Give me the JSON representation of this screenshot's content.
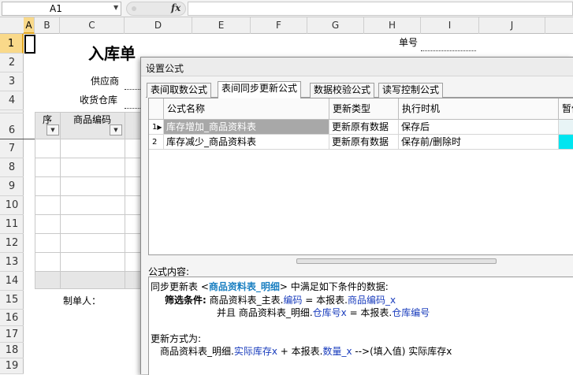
{
  "formula_bar": {
    "cell_ref": "A1",
    "fx_label": "fx"
  },
  "columns": [
    "A",
    "B",
    "C",
    "D",
    "E",
    "F",
    "G",
    "H",
    "I",
    "J"
  ],
  "rows": [
    "1",
    "2",
    "3",
    "4",
    "5",
    "6",
    "7",
    "8",
    "9",
    "10",
    "11",
    "12",
    "13",
    "14",
    "15",
    "16",
    "17",
    "18",
    "19"
  ],
  "sheet": {
    "title": "入库单",
    "doc_no_label": "单号",
    "supplier_label": "供应商",
    "warehouse_label": "收货仓库",
    "table_headers": [
      "序",
      "商品编码"
    ],
    "maker_label": "制单人："
  },
  "dialog": {
    "title": "设置公式",
    "tabs": [
      "表间取数公式",
      "表间同步更新公式",
      "数据校验公式",
      "读写控制公式"
    ],
    "active_tab": 1,
    "grid_headers": [
      "公式名称",
      "更新类型",
      "执行时机",
      "暂停"
    ],
    "grid_rows": [
      {
        "index": "1",
        "name": "库存增加_商品资料表",
        "update_type": "更新原有数据",
        "timing": "保存后"
      },
      {
        "index": "2",
        "name": "库存减少_商品资料表",
        "update_type": "更新原有数据",
        "timing": "保存前/删除时"
      }
    ],
    "formula_label": "公式内容:",
    "formula": {
      "l1_a": "同步更新表 <",
      "l1_b": "商品资料表_明细",
      "l1_c": "> 中满足如下条件的数据:",
      "l2_a": "筛选条件:",
      "l2_b": " 商品资料表_主表.",
      "l2_c": "编码",
      "l2_d": " = 本报表.",
      "l2_e": "商品编码_x",
      "l3_a": "并且 商品资料表_明细.",
      "l3_b": "仓库号x",
      "l3_c": " = 本报表.",
      "l3_d": "仓库编号",
      "l4": "更新方式为:",
      "l5_a": "商品资料表_明细.",
      "l5_b": "实际库存x",
      "l5_c": " + 本报表.",
      "l5_d": "数量_x",
      "l5_e": " -->(填入值) 实际库存x"
    }
  },
  "colors": {
    "selected_header": "#f9d98a",
    "cyan_cell": "#00e5f0",
    "keyword_blue": "#1a3dbd"
  }
}
